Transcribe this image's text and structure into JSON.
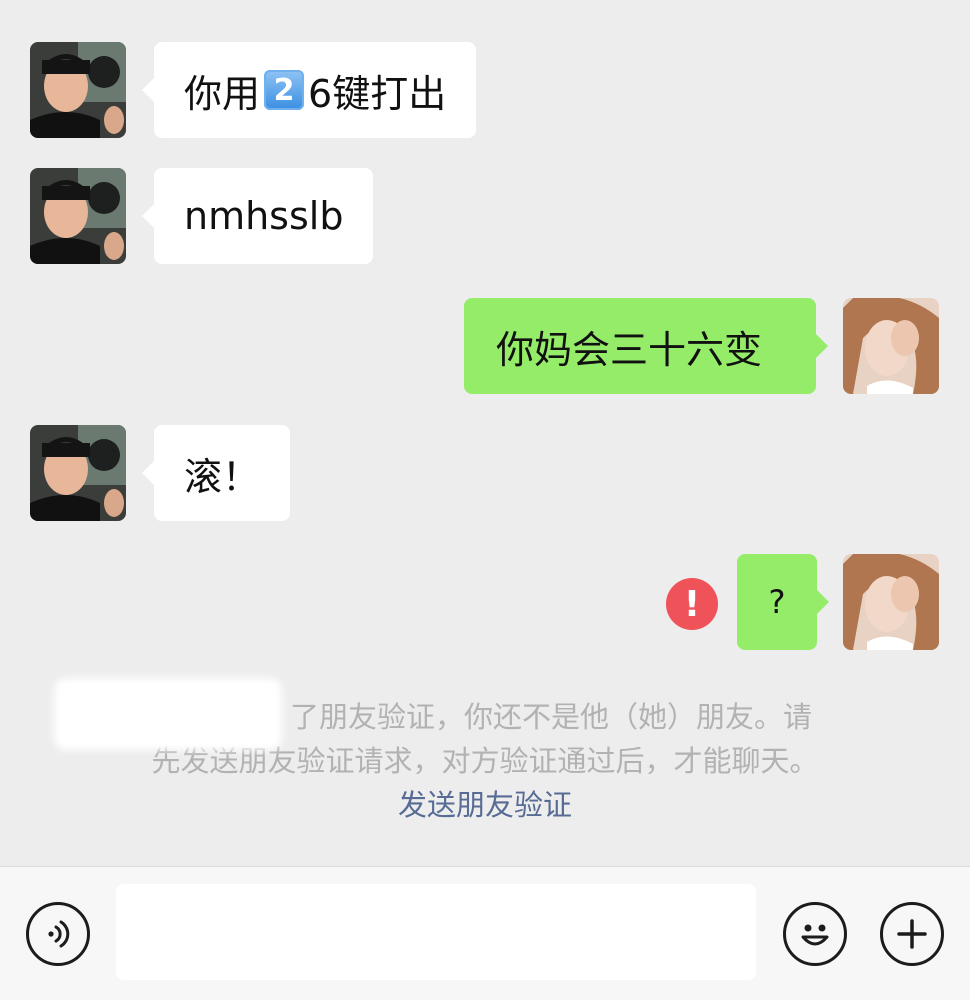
{
  "messages": [
    {
      "side": "left",
      "text_before": "你用",
      "key_emoji": "2",
      "text_after": "6键打出"
    },
    {
      "side": "left",
      "text": "nmhsslb"
    },
    {
      "side": "right",
      "text": "你妈会三十六变"
    },
    {
      "side": "left",
      "text": "滚！"
    },
    {
      "side": "right",
      "text": "?",
      "status": "failed"
    }
  ],
  "system_note": {
    "line1": "了朋友验证，你还不是他（她）朋友。请",
    "line2": "先发送朋友验证请求，对方验证通过后，才能聊天。",
    "link": "发送朋友验证"
  },
  "input_bar": {
    "voice_icon": "voice-icon",
    "emoji_icon": "emoji-icon",
    "plus_icon": "plus-icon",
    "placeholder": ""
  },
  "colors": {
    "background": "#ededed",
    "bubble_left": "#ffffff",
    "bubble_right": "#95ec69",
    "error": "#f0525a",
    "link": "#576b95",
    "note_text": "#b2b2b2"
  }
}
